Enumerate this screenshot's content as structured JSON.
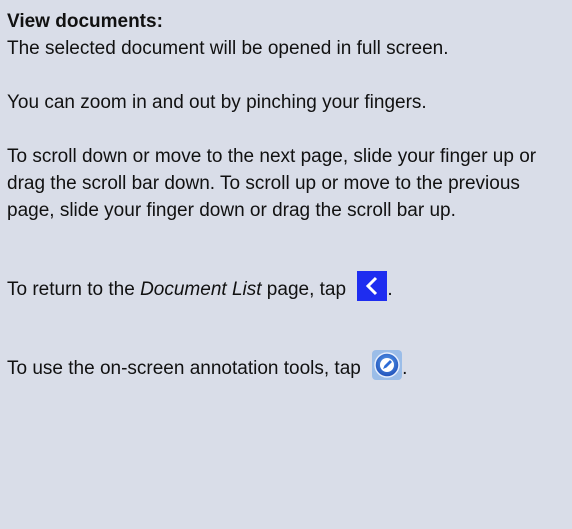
{
  "heading": "View documents:",
  "paragraphs": {
    "p1": "The selected document will be opened in full screen.",
    "p2": "You can zoom in and out by pinching your fingers.",
    "p3": "To scroll down or move to the next page, slide your finger up or drag the scroll bar down. To scroll up or move to the previous page, slide your finger down or drag the scroll bar up.",
    "p4_before": "To return to the ",
    "p4_emph": "Document List",
    "p4_after": " page, tap",
    "p4_end": ".",
    "p5_before": "To use the on-screen annotation tools, tap",
    "p5_end": "."
  },
  "icons": {
    "back": "chevron-left-icon",
    "annotate": "pen-circle-icon"
  },
  "colors": {
    "background": "#d9dde8",
    "back_button": "#1e2df0",
    "annotate_button": "#2c6bd6"
  }
}
